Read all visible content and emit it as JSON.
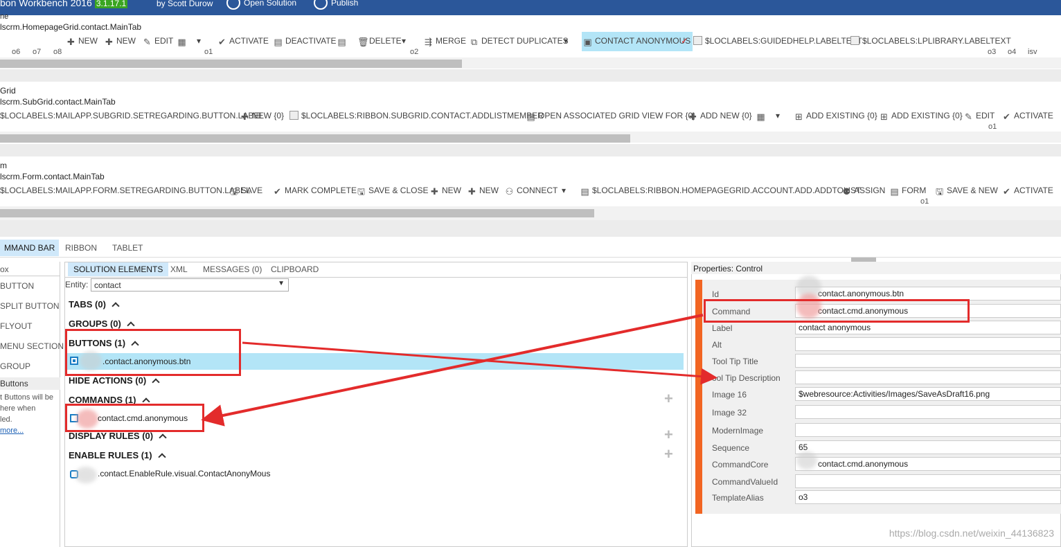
{
  "titlebar": {
    "title": "bon Workbench 2016",
    "version": "3.1.17.1",
    "author": "by Scott Durow",
    "open_solution": "Open Solution",
    "publish": "Publish"
  },
  "homepage_ribbon": {
    "line0": "ne",
    "id": "lscrm.HomepageGrid.contact.MainTab",
    "buttons": {
      "new1": "NEW",
      "new2": "NEW",
      "edit": "EDIT",
      "activate": "ACTIVATE",
      "deactivate": "DEACTIVATE",
      "delete": "DELETE",
      "merge": "MERGE",
      "detect_duplicates": "DETECT DUPLICATES",
      "contact_anonymous": "CONTACT ANONYMOUS",
      "guidedhelp": "$LOCLABELS:GUIDEDHELP.LABELTEXT",
      "lplibrary": "$LOCLABELS:LPLIBRARY.LABELTEXT"
    },
    "groups": {
      "o6": "o6",
      "o7": "o7",
      "o8": "o8",
      "o1": "o1",
      "o2": "o2",
      "o3": "o3",
      "o4": "o4",
      "isv": "isv"
    }
  },
  "subgrid_ribbon": {
    "line0": "Grid",
    "id": "lscrm.SubGrid.contact.MainTab",
    "buttons": {
      "setregarding": "$LOCLABELS:MAILAPP.SUBGRID.SETREGARDING.BUTTON.LABEL",
      "new": "NEW {0}",
      "addlistmember": "$LOCLABELS:RIBBON.SUBGRID.CONTACT.ADDLISTMEMBER",
      "open_associated": "OPEN ASSOCIATED GRID VIEW FOR {0}",
      "add_new": "ADD NEW {0}",
      "add_existing1": "ADD EXISTING {0}",
      "add_existing2": "ADD EXISTING {0}",
      "edit": "EDIT",
      "activate": "ACTIVATE"
    },
    "group_o1": "o1"
  },
  "form_ribbon": {
    "line0": "m",
    "id": "lscrm.Form.contact.MainTab",
    "buttons": {
      "setregarding": "$LOCLABELS:MAILAPP.FORM.SETREGARDING.BUTTON.LABEL",
      "save": "SAVE",
      "mark_complete": "MARK COMPLETE",
      "save_close": "SAVE & CLOSE",
      "new1": "NEW",
      "new2": "NEW",
      "connect": "CONNECT",
      "addtolist": "$LOCLABELS:RIBBON.HOMEPAGEGRID.ACCOUNT.ADD.ADDTOLIST",
      "assign": "ASSIGN",
      "form": "FORM",
      "save_new": "SAVE & NEW",
      "activate": "ACTIVATE"
    },
    "group_o1": "o1"
  },
  "main_tabs": [
    "MMAND BAR",
    "RIBBON",
    "TABLET"
  ],
  "toolbox": {
    "header": "ox",
    "items": [
      "BUTTON",
      "SPLIT BUTTON",
      "FLYOUT",
      "MENU SECTION",
      "GROUP"
    ],
    "help_title": "Buttons",
    "help_lines": [
      "t Buttons will be",
      "here when",
      "led."
    ],
    "more": "more..."
  },
  "solution_tabs": [
    "SOLUTION ELEMENTS",
    "XML",
    "MESSAGES (0)",
    "CLIPBOARD"
  ],
  "entity": {
    "label": "Entity:",
    "value": "contact"
  },
  "tree": {
    "tabs": "TABS (0)",
    "groups": "GROUPS (0)",
    "buttons": "BUTTONS (1)",
    "button_item": ".contact.anonymous.btn",
    "hide_actions": "HIDE ACTIONS (0)",
    "commands": "COMMANDS (1)",
    "command_item": "contact.cmd.anonymous",
    "display_rules": "DISPLAY RULES (0)",
    "enable_rules": "ENABLE RULES (1)",
    "enable_item": ".contact.EnableRule.visual.ContactAnonyMous"
  },
  "properties": {
    "title": "Properties: Control",
    "fields": [
      {
        "label": "Id",
        "value": "contact.anonymous.btn"
      },
      {
        "label": "Command",
        "value": "contact.cmd.anonymous"
      },
      {
        "label": "Label",
        "value": "contact anonymous"
      },
      {
        "label": "Alt",
        "value": ""
      },
      {
        "label": "Tool Tip Title",
        "value": ""
      },
      {
        "label": "ool Tip Description",
        "value": ""
      },
      {
        "label": "Image 16",
        "value": "$webresource:Activities/Images/SaveAsDraft16.png"
      },
      {
        "label": "Image 32",
        "value": ""
      },
      {
        "label": "ModernImage",
        "value": ""
      },
      {
        "label": "Sequence",
        "value": "65"
      },
      {
        "label": "CommandCore",
        "value": "contact.cmd.anonymous"
      },
      {
        "label": "CommandValueId",
        "value": ""
      },
      {
        "label": "TemplateAlias",
        "value": "o3"
      }
    ]
  },
  "watermark": "https://blog.csdn.net/weixin_44136823",
  "colors": {
    "title_bar": "#2b579a",
    "selection": "#b3e5f7",
    "annotation_red": "#e32b2b",
    "accent_orange": "#f26522"
  }
}
